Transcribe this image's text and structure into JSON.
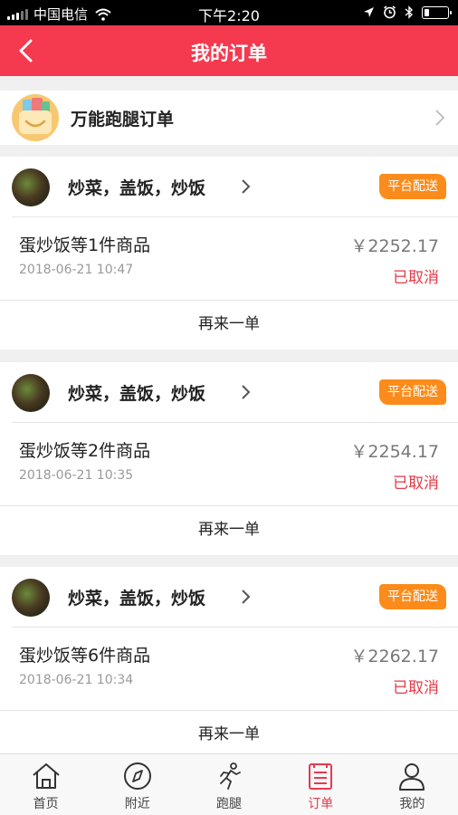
{
  "status_bar": {
    "carrier": "中国电信",
    "time": "下午2:20"
  },
  "header": {
    "title": "我的订单",
    "back_icon": "chevron-left-icon"
  },
  "runner_order": {
    "label": "万能跑腿订单",
    "icon": "chevron-right-icon"
  },
  "orders": [
    {
      "shop_name": "炒菜，盖饭，炒饭",
      "badge": "平台配送",
      "items": "蛋炒饭等1件商品",
      "price": "￥2252.17",
      "time": "2018-06-21 10:47",
      "status": "已取消",
      "action": "再来一单"
    },
    {
      "shop_name": "炒菜，盖饭，炒饭",
      "badge": "平台配送",
      "items": "蛋炒饭等2件商品",
      "price": "￥2254.17",
      "time": "2018-06-21 10:35",
      "status": "已取消",
      "action": "再来一单"
    },
    {
      "shop_name": "炒菜，盖饭，炒饭",
      "badge": "平台配送",
      "items": "蛋炒饭等6件商品",
      "price": "￥2262.17",
      "time": "2018-06-21 10:34",
      "status": "已取消",
      "action": "再来一单"
    }
  ],
  "tabs": [
    {
      "label": "首页",
      "icon": "home-icon",
      "active": false
    },
    {
      "label": "附近",
      "icon": "compass-icon",
      "active": false
    },
    {
      "label": "跑腿",
      "icon": "runner-icon",
      "active": false
    },
    {
      "label": "订单",
      "icon": "order-list-icon",
      "active": true
    },
    {
      "label": "我的",
      "icon": "user-icon",
      "active": false
    }
  ],
  "colors": {
    "brand": "#f5394f",
    "badge": "#fb8c1b",
    "status_cancelled": "#e63946",
    "tab_active": "#e8384f"
  }
}
